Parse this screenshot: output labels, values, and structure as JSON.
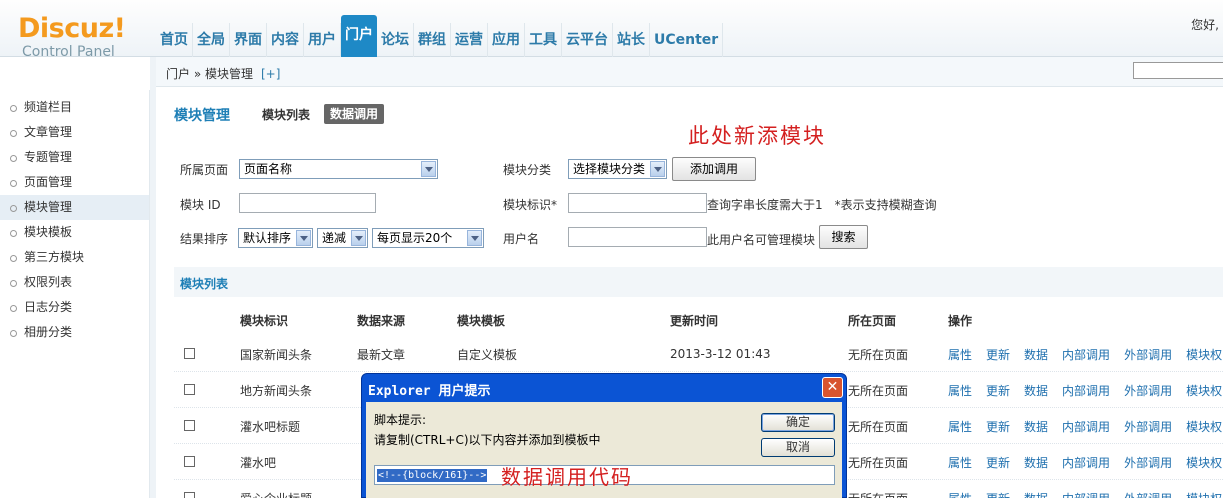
{
  "header": {
    "logo_brand": "Discuz!",
    "logo_sub": "Control Panel",
    "nav": [
      "首页",
      "全局",
      "界面",
      "内容",
      "用户",
      "门户",
      "论坛",
      "群组",
      "运营",
      "应用",
      "工具",
      "云平台",
      "站长",
      "UCenter"
    ],
    "nav_active": "门户",
    "hello": "您好,"
  },
  "crumb": {
    "path": "门户 » 模块管理",
    "add": "[+]"
  },
  "sidebar": {
    "items": [
      "频道栏目",
      "文章管理",
      "专题管理",
      "页面管理",
      "模块管理",
      "模块模板",
      "第三方模块",
      "权限列表",
      "日志分类",
      "相册分类"
    ],
    "active": "模块管理"
  },
  "main": {
    "title": "模块管理",
    "tab_list": "模块列表",
    "tab_data": "数据调用",
    "annotation_top": "此处新添模块",
    "filters": {
      "page_label": "所属页面",
      "page_value": "页面名称",
      "category_label": "模块分类",
      "category_value": "选择模块分类",
      "add_button": "添加调用",
      "id_label": "模块 ID",
      "ident_label": "模块标识*",
      "ident_hint": "查询字串长度需大于1　*表示支持模糊查询",
      "sort_label": "结果排序",
      "sort_value": "默认排序",
      "order_value": "递减",
      "perpage_value": "每页显示20个",
      "user_label": "用户名",
      "user_hint": "此用户名可管理模块",
      "search_button": "搜索"
    },
    "section_title": "模块列表",
    "columns": [
      "模块标识",
      "数据来源",
      "模块模板",
      "更新时间",
      "所在页面",
      "操作"
    ],
    "rows": [
      {
        "ident": "国家新闻头条",
        "source": "最新文章",
        "tpl": "自定义模板",
        "time": "2013-3-12 01:43",
        "page": "无所在页面"
      },
      {
        "ident": "地方新闻头条",
        "source": "",
        "tpl": "",
        "time": "",
        "page": "无所在页面"
      },
      {
        "ident": "灌水吧标题",
        "source": "",
        "tpl": "",
        "time": "",
        "page": "无所在页面"
      },
      {
        "ident": "灌水吧",
        "source": "",
        "tpl": "",
        "time": "",
        "page": "无所在页面"
      },
      {
        "ident": "爱心企业标题",
        "source": "",
        "tpl": "",
        "time": "",
        "page": "无所在页面"
      }
    ],
    "ops": [
      "属性",
      "更新",
      "数据",
      "内部调用",
      "外部调用",
      "模块权限"
    ]
  },
  "dialog": {
    "title": "Explorer 用户提示",
    "close": "✕",
    "line1": "脚本提示:",
    "line2": "请复制(CTRL+C)以下内容并添加到模板中",
    "ok": "确定",
    "cancel": "取消",
    "code": "<!--{block/161}-->",
    "annotation": "数据调用代码"
  },
  "colors": {
    "accent": "#1e89c6",
    "logo": "#f49a1e",
    "annotation": "#d42020",
    "dialog": "#0b54d4"
  }
}
